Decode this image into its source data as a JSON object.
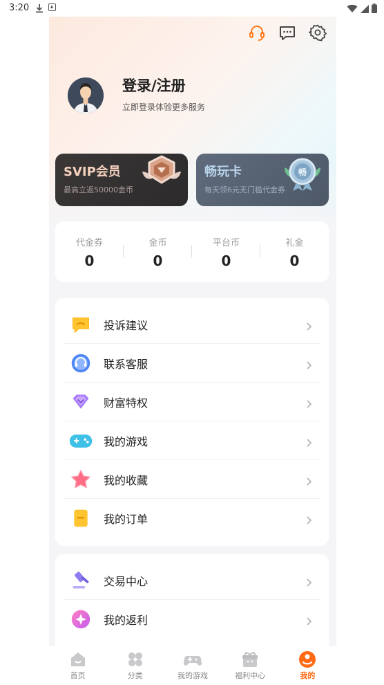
{
  "status_bar": {
    "time": "3:20"
  },
  "profile": {
    "title": "登录/注册",
    "subtitle": "立即登录体验更多服务"
  },
  "cards": {
    "svip": {
      "title": "SVIP会员",
      "subtitle": "最高立返50000金币"
    },
    "changwan": {
      "title": "畅玩卡",
      "subtitle": "每天领6元无门槛代金券",
      "badge_char": "畅"
    }
  },
  "stats": [
    {
      "label": "代金券",
      "value": "0"
    },
    {
      "label": "金币",
      "value": "0"
    },
    {
      "label": "平台币",
      "value": "0"
    },
    {
      "label": "礼金",
      "value": "0"
    }
  ],
  "menu_main": [
    {
      "label": "投诉建议",
      "icon": "complaint-icon"
    },
    {
      "label": "联系客服",
      "icon": "customer-service-icon"
    },
    {
      "label": "财富特权",
      "icon": "diamond-icon"
    },
    {
      "label": "我的游戏",
      "icon": "gamepad-icon"
    },
    {
      "label": "我的收藏",
      "icon": "star-icon"
    },
    {
      "label": "我的订单",
      "icon": "order-icon"
    }
  ],
  "menu_secondary": [
    {
      "label": "交易中心",
      "icon": "gavel-icon"
    },
    {
      "label": "我的返利",
      "icon": "rebate-icon"
    }
  ],
  "tabs": [
    {
      "label": "首页",
      "icon": "home-icon",
      "active": false
    },
    {
      "label": "分类",
      "icon": "category-icon",
      "active": false
    },
    {
      "label": "我的游戏",
      "icon": "gamepad-icon",
      "active": false
    },
    {
      "label": "福利中心",
      "icon": "gift-icon",
      "active": false
    },
    {
      "label": "我的",
      "icon": "profile-icon",
      "active": true
    }
  ],
  "colors": {
    "accent": "#ff6a14",
    "background": "#f5f5f7"
  }
}
